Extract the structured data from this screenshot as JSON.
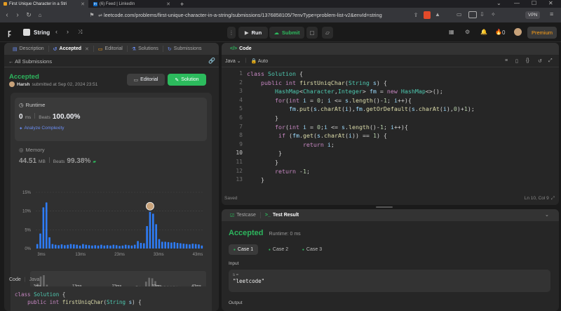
{
  "browser": {
    "tabs": [
      {
        "title": "First Unique Character in a Stri"
      },
      {
        "title": "(6) Feed | LinkedIn"
      }
    ],
    "url": "leetcode.com/problems/first-unique-character-in-a-string/submissions/1376858105/?envType=problem-list-v2&envId=string",
    "vpn_label": "VPN"
  },
  "nav": {
    "problem_list_label": "String",
    "run_label": "Run",
    "submit_label": "Submit",
    "streak_count": "0",
    "premium_label": "Premium"
  },
  "left_panel": {
    "tabs": [
      {
        "label": "Description",
        "active": false
      },
      {
        "label": "Accepted",
        "active": true
      },
      {
        "label": "Editorial",
        "active": false
      },
      {
        "label": "Solutions",
        "active": false
      },
      {
        "label": "Submissions",
        "active": false
      }
    ],
    "back_label": "All Submissions",
    "status": "Accepted",
    "user": "Harsh",
    "submitted_text": "submitted at Sep 02, 2024 23:51",
    "editorial_btn": "Editorial",
    "solution_btn": "Solution",
    "runtime": {
      "label": "Runtime",
      "value": "0",
      "unit": "ms",
      "beats_label": "Beats",
      "beats_value": "100.00%",
      "analyze_label": "Analyze Complexity"
    },
    "memory": {
      "label": "Memory",
      "value": "44.51",
      "unit": "MB",
      "beats_label": "Beats",
      "beats_value": "99.38%"
    },
    "code_tabs": [
      "Code",
      "Java"
    ],
    "code_preview": [
      "class Solution {",
      "    public int firstUniqChar(String s) {"
    ]
  },
  "chart_data": {
    "type": "bar",
    "x_ticks": [
      "3ms",
      "13ms",
      "23ms",
      "33ms",
      "43ms"
    ],
    "y_ticks": [
      "15%",
      "10%",
      "5%",
      "0%"
    ],
    "ylim": [
      0,
      15
    ],
    "values": [
      1.2,
      4,
      11,
      12.3,
      3,
      1.2,
      1,
      0.9,
      1.1,
      0.9,
      1,
      1.2,
      1.1,
      1,
      0.8,
      1.2,
      1,
      0.9,
      0.8,
      0.9,
      0.8,
      1,
      0.8,
      0.9,
      0.8,
      1,
      0.9,
      0.7,
      0.8,
      1,
      0.9,
      0.8,
      1,
      2,
      1.5,
      1.4,
      6,
      9.8,
      9.3,
      6.5,
      2.5,
      1.8,
      1.8,
      1.7,
      1.6,
      1.7,
      1.5,
      1.4,
      1.3,
      1.2,
      1.1,
      1.3,
      1.2,
      1.1,
      0.8
    ],
    "highlight_indices": [
      36,
      37,
      38,
      39
    ],
    "bar_color": "#2e7cf6",
    "mini_x_ticks": [
      "3ms",
      "13ms",
      "23ms",
      "33ms",
      "43ms"
    ]
  },
  "editor": {
    "title": "Code",
    "language": "Java",
    "mode": "Auto",
    "status_left": "Saved",
    "status_right": "Ln 10, Col 9",
    "line_numbers": [
      "1",
      "2",
      "3",
      "4",
      "5",
      "6",
      "7",
      "8",
      "9",
      "10",
      "11",
      "12",
      "13"
    ]
  },
  "bottom_panel": {
    "tabs": [
      {
        "label": "Testcase",
        "active": false
      },
      {
        "label": "Test Result",
        "active": true
      }
    ],
    "result": "Accepted",
    "runtime_text": "Runtime: 0 ms",
    "cases": [
      "Case 1",
      "Case 2",
      "Case 3"
    ],
    "input_label": "Input",
    "var_name": "s =",
    "var_value": "\"leetcode\"",
    "output_label": "Output"
  },
  "colors": {
    "accent_green": "#2cbb5d",
    "status_green": "#2db55d",
    "premium": "#ffa116",
    "link_blue": "#6b8ef5"
  }
}
